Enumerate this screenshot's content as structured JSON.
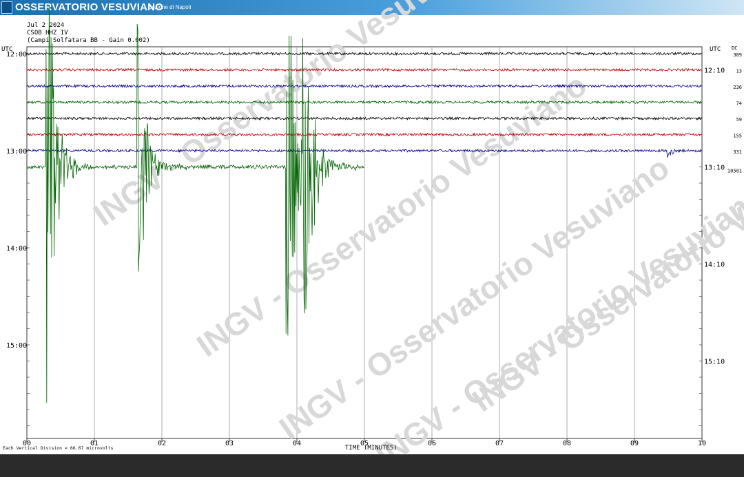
{
  "header": {
    "title": "OSSERVATORIO VESUVIANO",
    "subtitle": "Sezione di Napoli"
  },
  "info": {
    "date": "Jul 2 2024",
    "station": "CSOB HHZ IV",
    "site": "(Campi Solfatara BB - Gain 0.002)"
  },
  "watermark": {
    "text": "INGV - Osservatorio Vesuviano"
  },
  "chart_data": {
    "type": "line",
    "title": "",
    "xlabel": "TIME (MINUTES)",
    "ylabel": "",
    "xlim": [
      0,
      10
    ],
    "x_ticks": [
      "00",
      "01",
      "02",
      "03",
      "04",
      "05",
      "06",
      "07",
      "08",
      "09",
      "10"
    ],
    "left_axis_title": "UTC",
    "right_axis_title": "UTC",
    "dc_header": "DC",
    "left_time_labels": [
      "12:00",
      "13:00",
      "14:00",
      "15:00"
    ],
    "right_time_labels": [
      "12:10",
      "13:10",
      "14:10",
      "15:10"
    ],
    "scale_note": "Each Vertical Division = 66.67 microvolts",
    "traces": [
      {
        "start": "12:00",
        "color": "#000000",
        "dc": "389",
        "end_minute": 10
      },
      {
        "start": "12:10",
        "color": "#c00000",
        "dc": "13",
        "end_minute": 10
      },
      {
        "start": "12:20",
        "color": "#00008b",
        "dc": "236",
        "end_minute": 10
      },
      {
        "start": "12:30",
        "color": "#006400",
        "dc": "74",
        "end_minute": 10
      },
      {
        "start": "12:40",
        "color": "#000000",
        "dc": "59",
        "end_minute": 10
      },
      {
        "start": "12:50",
        "color": "#c00000",
        "dc": "155",
        "end_minute": 10
      },
      {
        "start": "13:00",
        "color": "#00008b",
        "dc": "331",
        "end_minute": 10
      },
      {
        "start": "13:10",
        "color": "#006400",
        "dc": "10501",
        "end_minute": 5.0
      }
    ],
    "events": [
      {
        "trace": 7,
        "minute": 0.3,
        "description": "large earthquake signal"
      },
      {
        "trace": 7,
        "minute": 1.65,
        "description": "earthquake signal"
      },
      {
        "trace": 7,
        "minute": 3.85,
        "description": "large earthquake signal"
      },
      {
        "trace": 7,
        "minute": 4.1,
        "description": "large earthquake signal"
      },
      {
        "trace": 6,
        "minute": 9.5,
        "description": "small event"
      }
    ]
  }
}
